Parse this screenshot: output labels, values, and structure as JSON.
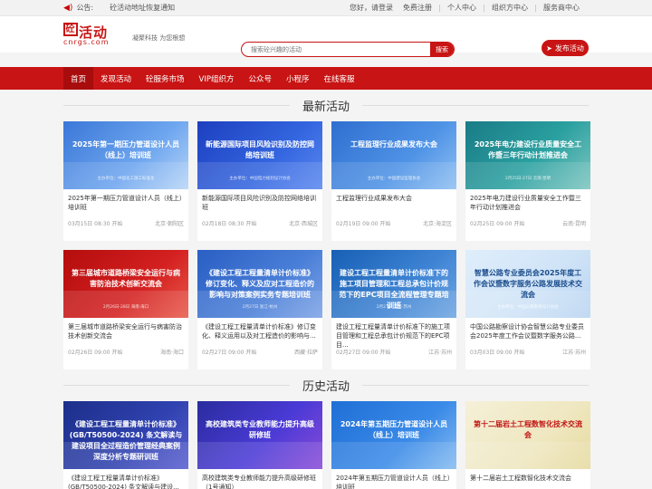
{
  "topbar": {
    "notice_label": "公告:",
    "notice_text": "砼活动地址恢复通知",
    "greeting": "您好，请登录",
    "register": "免费注册",
    "personal_center": "个人中心",
    "organizer_center": "组织方中心",
    "merchant_center": "服务商中心"
  },
  "header": {
    "logo_main": "砼活动",
    "logo_box": "砼",
    "logo_text": "活动",
    "logo_domain": "cnrgs.com",
    "slogan": "凝聚科技 为您根想",
    "search_placeholder": "搜索砼兴趣的活动",
    "search_button": "搜索",
    "publish_button": "发布活动"
  },
  "nav": [
    {
      "label": "首页",
      "active": true
    },
    {
      "label": "发现活动",
      "active": false
    },
    {
      "label": "砼服务市场",
      "active": false
    },
    {
      "label": "VIP组织方",
      "active": false
    },
    {
      "label": "公众号",
      "active": false
    },
    {
      "label": "小程序",
      "active": false
    },
    {
      "label": "在线客服",
      "active": false
    }
  ],
  "latest": {
    "title": "最新活动",
    "cards": [
      {
        "banner": "2025年第一期压力管道设计人员（线上）培训班",
        "banner_sub": "主办单位：中国化工施工标准化",
        "title": "2025年第一期压力管道设计人员（线上）培训班",
        "date": "03月15日 08:30 开始",
        "location": "北京·朝阳区",
        "bg": "bg-blue"
      },
      {
        "banner": "新能源国际项目风险识别及防控网络培训班",
        "banner_sub": "主办单位：中国电力规划设计协会",
        "title": "新能源国际项目风险识别及防控网络培训班",
        "date": "02月18日 08:30 开始",
        "location": "北京·西城区",
        "bg": "bg-deep"
      },
      {
        "banner": "工程监理行业成果发布大会",
        "banner_sub": "主办单位：中国建设监理协会",
        "title": "工程监理行业成果发布大会",
        "date": "02月19日 09:00 开始",
        "location": "北京·海淀区",
        "bg": "bg-sky"
      },
      {
        "banner": "2025年电力建设行业质量安全工作暨三年行动计划推进会",
        "banner_sub": "2月25日-27日 云南·昆明",
        "title": "2025年电力建设行业质量安全工作暨三年行动计划推进会",
        "date": "02月25日 09:00 开始",
        "location": "云南·昆明",
        "bg": "bg-teal"
      },
      {
        "banner": "第三届城市道路桥梁安全运行与病害防治技术创新交流会",
        "banner_sub": "2月26日-28日 海南·海口",
        "title": "第三届城市道路桥梁安全运行与病害防治技术创新交流会",
        "date": "02月26日 09:00 开始",
        "location": "海南·海口",
        "bg": "bg-red"
      },
      {
        "banner": "《建设工程工程量清单计价标准》修订变化、释义及应对工程造价的影响与对策案例实务专题培训班",
        "banner_sub": "2月27日 浙江·杭州",
        "title": "《建设工程工程量清单计价标准》修订变化、释义运用以及对工程造价的影响与...",
        "date": "02月27日 09:00 开始",
        "location": "西藏·拉萨",
        "bg": "bg-lblue"
      },
      {
        "banner": "建设工程工程量清单计价标准下的施工项目管理和工程总承包计价规范下的EPC项目全流程管理专题培训班",
        "banner_sub": "2月27日 江苏·苏州",
        "title": "建设工程工程量清单计价标准下的施工项目管理和工程总承包计价规范下的EPC项目...",
        "date": "02月27日 09:00 开始",
        "location": "江苏·苏州",
        "bg": "bg-ocean"
      },
      {
        "banner": "智慧公路专业委员会2025年度工作会议暨数字服务公路发展技术交流会",
        "banner_sub": "主办单位：中国公路勘察设计协会",
        "title": "中国公路勘察设计协会智慧公路专业委员会2025年度工作会议暨数字服务公路...",
        "date": "03月03日 09:00 开始",
        "location": "江苏·苏州",
        "bg": "bg-light"
      }
    ]
  },
  "history": {
    "title": "历史活动",
    "cards": [
      {
        "banner": "《建设工程工程量清单计价标准》(GB/T50500-2024) 条文解读与建设项目全过程造价管理经典案例深度分析专题研训班",
        "banner_sub": "",
        "title": "《建设工程工程量清单计价标准》(GB/T50500-2024) 条文解读与建设...",
        "bg": "bg-navy"
      },
      {
        "banner": "高校建筑类专业教师能力提升高级研修班",
        "banner_sub": "",
        "title": "高校建筑类专业教师能力提升高级研修班（1号通知）",
        "bg": "bg-purple"
      },
      {
        "banner": "2024年第五期压力管道设计人员（线上）培训班",
        "banner_sub": "",
        "title": "2024年第五期压力管道设计人员（线上）培训班",
        "bg": "bg-sky2"
      },
      {
        "banner": "第十二届岩土工程数智化技术交流会",
        "banner_sub": "",
        "title": "第十二届岩土工程数智化技术交流会",
        "bg": "bg-cream"
      }
    ]
  },
  "colors": {
    "brand": "#c81414"
  }
}
